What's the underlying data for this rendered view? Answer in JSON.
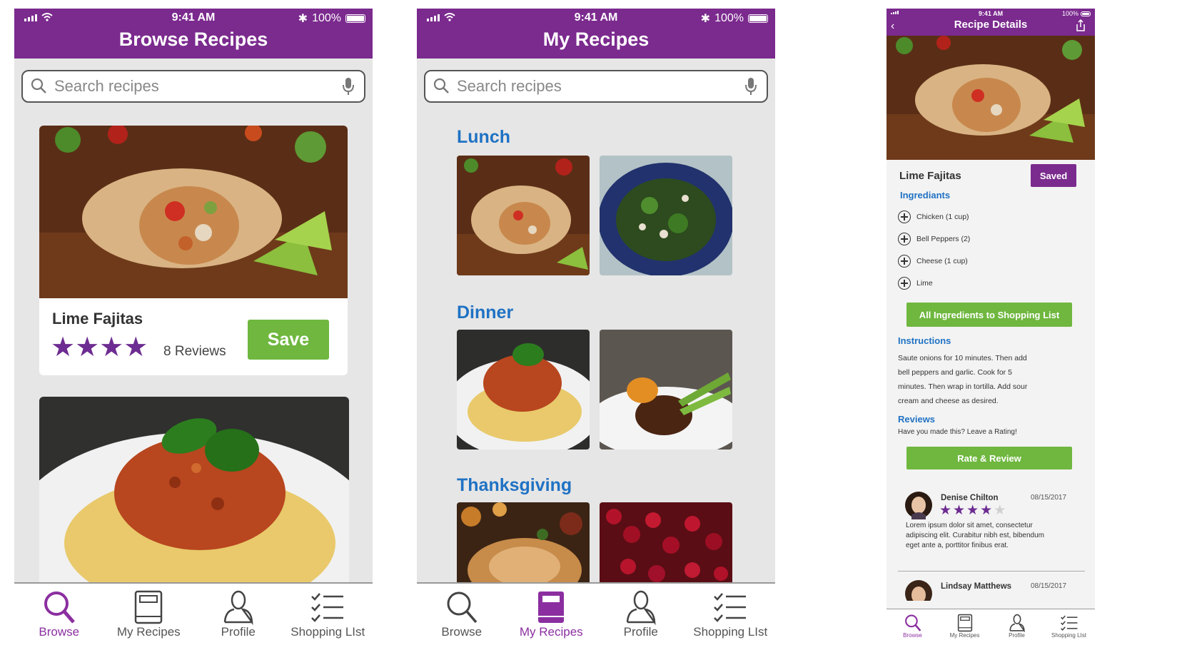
{
  "status": {
    "time": "9:41 AM",
    "battery": "100%"
  },
  "browse": {
    "title": "Browse Recipes",
    "search_placeholder": "Search recipes",
    "card1": {
      "name": "Lime Fajitas",
      "rating": 4,
      "reviews": "8 Reviews",
      "save_label": "Save"
    }
  },
  "my_recipes": {
    "title": "My Recipes",
    "search_placeholder": "Search recipes",
    "sections": [
      "Lunch",
      "Dinner",
      "Thanksgiving"
    ]
  },
  "details": {
    "title": "Recipe Details",
    "name": "Lime Fajitas",
    "saved_label": "Saved",
    "ingredients_title": "Ingrediants",
    "ingredients": [
      "Chicken (1 cup)",
      "Bell Peppers (2)",
      "Cheese (1 cup)",
      "Lime"
    ],
    "add_all_label": "All Ingredients to Shopping List",
    "instructions_title": "Instructions",
    "instructions_lines": [
      "Saute onions for 10 minutes. Then add",
      "bell peppers and garlic. Cook for 5",
      "minutes. Then wrap in tortilla. Add sour",
      "cream and cheese as desired."
    ],
    "reviews_title": "Reviews",
    "reviews_prompt": "Have you made this? Leave a Rating!",
    "rate_label": "Rate & Review",
    "review1": {
      "name": "Denise Chilton",
      "date": "08/15/2017",
      "rating": 4,
      "text_lines": [
        "Lorem ipsum dolor sit amet, consectetur",
        "adipiscing elit. Curabitur nibh est, bibendum",
        "eget ante a, porttitor finibus erat."
      ]
    },
    "review2": {
      "name": "Lindsay Matthews",
      "date": "08/15/2017"
    }
  },
  "tabs": {
    "browse": "Browse",
    "my_recipes": "My Recipes",
    "profile": "Profile",
    "shopping": "Shopping LIst"
  },
  "colors": {
    "brand": "#7b2a8e",
    "active_tab": "#8b2fa0",
    "section_blue": "#1f72c4",
    "action_green": "#6fb73f"
  },
  "icons": [
    "search-icon",
    "microphone-icon",
    "book-icon",
    "person-icon",
    "checklist-icon",
    "star-icon",
    "back-icon",
    "share-icon",
    "plus-icon",
    "wifi-icon",
    "bluetooth-icon",
    "battery-icon"
  ]
}
